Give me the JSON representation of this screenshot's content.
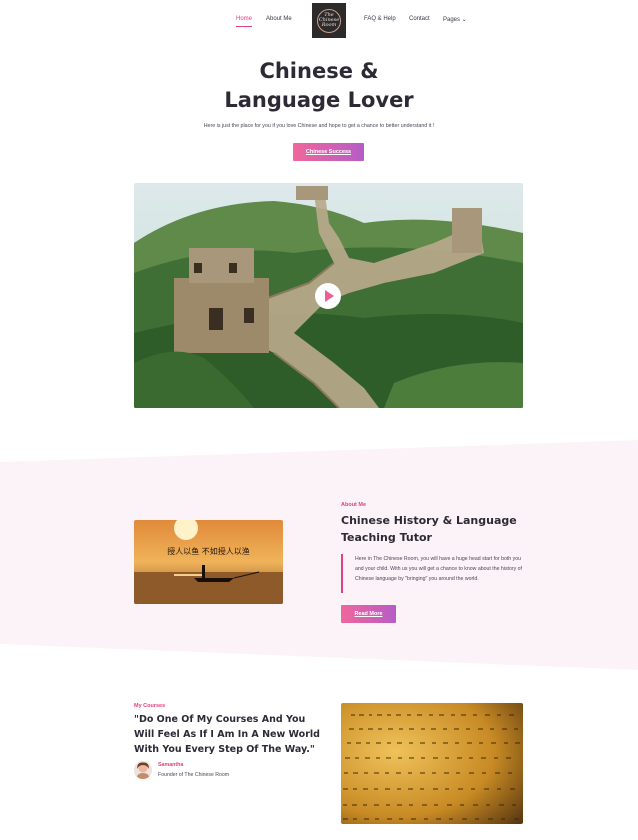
{
  "nav": {
    "items": [
      {
        "label": "Home"
      },
      {
        "label": "About Me"
      },
      {
        "label": "FAQ & Help"
      },
      {
        "label": "Contact"
      },
      {
        "label": "Pages ⌄"
      }
    ],
    "logo_text": "The Chinese Room"
  },
  "hero": {
    "title_line1": "Chinese &",
    "title_line2": "Language Lover",
    "subtitle": "Here is just the place for you if you love Chinese and hope to get a chance to better understand it !",
    "button_label": "Chinese Success"
  },
  "about": {
    "eyebrow": "About Me",
    "title": "Chinese History & Language Teaching Tutor",
    "text": "Here in The Chinese Room, you will have a huge head start for both you and your child. With us you will get a chance to know about the history of Chinese language by \"bringing\" you around the world.",
    "button_label": "Read More",
    "image_text": "授人以鱼 不如授人以渔"
  },
  "courses": {
    "eyebrow": "My Courses",
    "quote": "\"Do One Of My Courses And You Will Feel As If I Am In A New World With You Every Step Of The Way.\"",
    "author": "Samantha",
    "role": "Founder of The Chinese Room"
  },
  "colors": {
    "accent": "#e0407f",
    "gradient_start": "#f0679c",
    "gradient_end": "#b65cc6",
    "band_bg": "#fbf3f8",
    "dark_text": "#2d2a35"
  }
}
